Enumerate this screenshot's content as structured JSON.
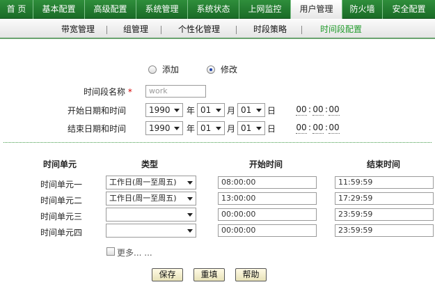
{
  "top_nav": {
    "tabs": [
      {
        "label": "首 页"
      },
      {
        "label": "基本配置"
      },
      {
        "label": "高级配置"
      },
      {
        "label": "系统管理"
      },
      {
        "label": "系统状态"
      },
      {
        "label": "上网监控"
      },
      {
        "label": "用户管理"
      },
      {
        "label": "防火墙"
      },
      {
        "label": "安全配置"
      }
    ],
    "active": "用户管理"
  },
  "sub_nav": {
    "items": [
      {
        "label": "带宽管理"
      },
      {
        "label": "组管理"
      },
      {
        "label": "个性化管理"
      },
      {
        "label": "时段策略"
      },
      {
        "label": "时间段配置"
      }
    ],
    "active": "时间段配置"
  },
  "mode": {
    "add_label": "添加",
    "edit_label": "修改",
    "selected": "修改"
  },
  "form": {
    "name_label": "时间段名称",
    "required_mark": "*",
    "name_value": "work",
    "start_label": "开始日期和时间",
    "end_label": "结束日期和时间",
    "year_unit": "年",
    "month_unit": "月",
    "day_unit": "日",
    "start": {
      "year": "1990",
      "month": "01",
      "day": "01",
      "hh": "00",
      "mm": "00",
      "ss": "00"
    },
    "end": {
      "year": "1990",
      "month": "01",
      "day": "01",
      "hh": "00",
      "mm": "00",
      "ss": "00"
    }
  },
  "units_table": {
    "headers": {
      "unit": "时间单元",
      "type": "类型",
      "start": "开始时间",
      "end": "结束时间"
    },
    "rows": [
      {
        "unit": "时间单元一",
        "type": "工作日(周一至周五)",
        "start": "08:00:00",
        "end": "11:59:59"
      },
      {
        "unit": "时间单元二",
        "type": "工作日(周一至周五)",
        "start": "13:00:00",
        "end": "17:29:59"
      },
      {
        "unit": "时间单元三",
        "type": "",
        "start": "00:00:00",
        "end": "23:59:59"
      },
      {
        "unit": "时间单元四",
        "type": "",
        "start": "00:00:00",
        "end": "23:59:59"
      }
    ]
  },
  "more_label": "更多... ...",
  "buttons": {
    "save": "保存",
    "reset": "重填",
    "help": "帮助"
  },
  "colors": {
    "nav_green": "#2f8e3b",
    "active_sub": "#1f9a2a",
    "required": "#d40000"
  }
}
